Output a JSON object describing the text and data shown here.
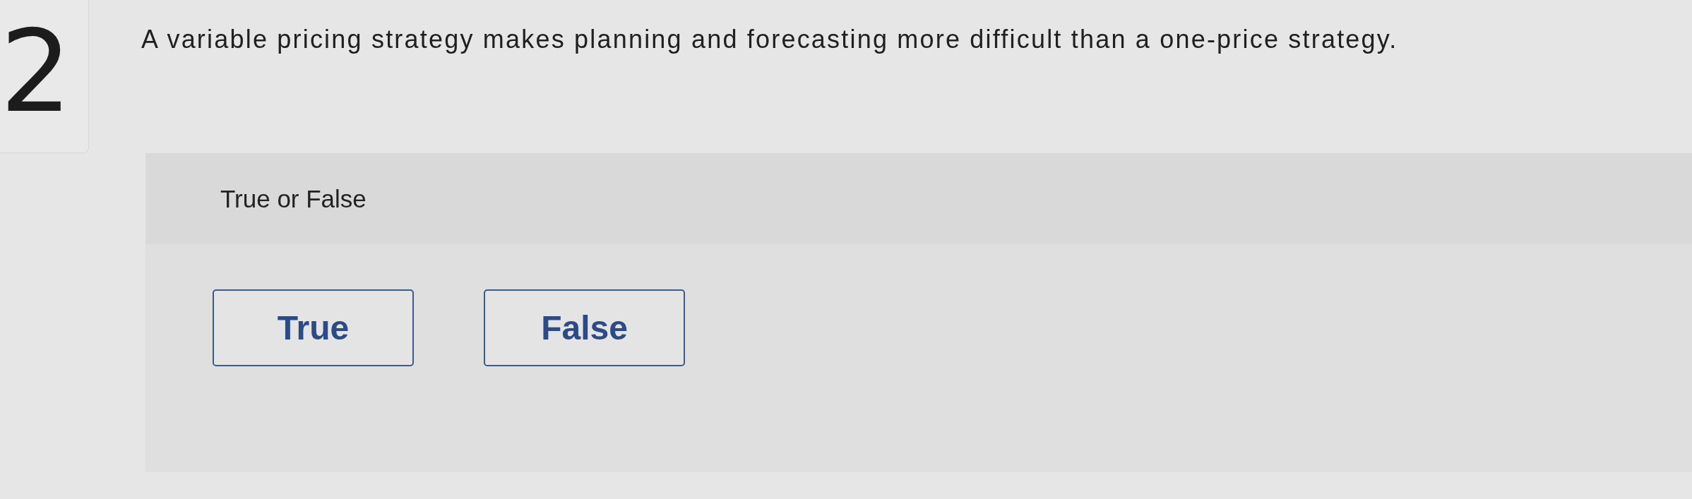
{
  "question": {
    "number": "2",
    "text": "A variable pricing strategy makes planning and forecasting more difficult than a one-price strategy."
  },
  "answer_panel": {
    "prompt": "True or False",
    "options": [
      {
        "label": "True",
        "selected": false
      },
      {
        "label": "False",
        "selected": false
      }
    ]
  }
}
